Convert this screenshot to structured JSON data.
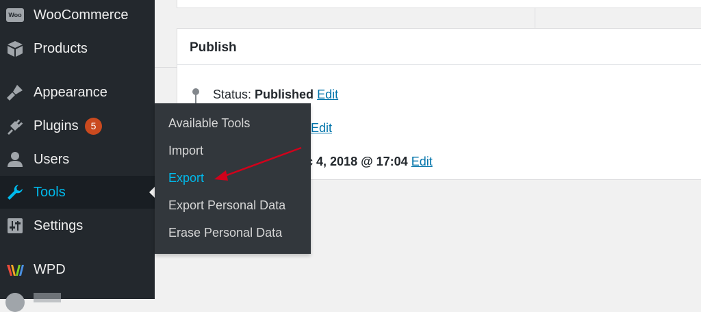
{
  "sidebar": {
    "items": [
      {
        "label": "WooCommerce",
        "icon": "woo-icon"
      },
      {
        "label": "Products",
        "icon": "box-icon"
      },
      {
        "label": "Appearance",
        "icon": "paintbrush-icon"
      },
      {
        "label": "Plugins",
        "icon": "plug-icon",
        "badge": "5"
      },
      {
        "label": "Users",
        "icon": "user-icon"
      },
      {
        "label": "Tools",
        "icon": "wrench-icon",
        "current": true
      },
      {
        "label": "Settings",
        "icon": "sliders-icon"
      },
      {
        "label": "WPD",
        "icon": "wpd-logo-icon"
      }
    ],
    "woo_logo_text": "Woo"
  },
  "flyout": {
    "items": [
      {
        "label": "Available Tools"
      },
      {
        "label": "Import"
      },
      {
        "label": "Export",
        "active": true
      },
      {
        "label": "Export Personal Data"
      },
      {
        "label": "Erase Personal Data"
      }
    ]
  },
  "publish": {
    "title": "Publish",
    "status_label": "Status:",
    "status_value": "Published",
    "status_edit": "Edit",
    "visibility_edit": "Edit",
    "date_partial": "ec 4, 2018 @ 17:04",
    "date_edit": "Edit"
  },
  "colors": {
    "sidebar_bg": "#23282d",
    "accent": "#00b9eb",
    "link": "#0073aa",
    "badge": "#ca4a1f",
    "annotation_arrow": "#d0021b"
  }
}
